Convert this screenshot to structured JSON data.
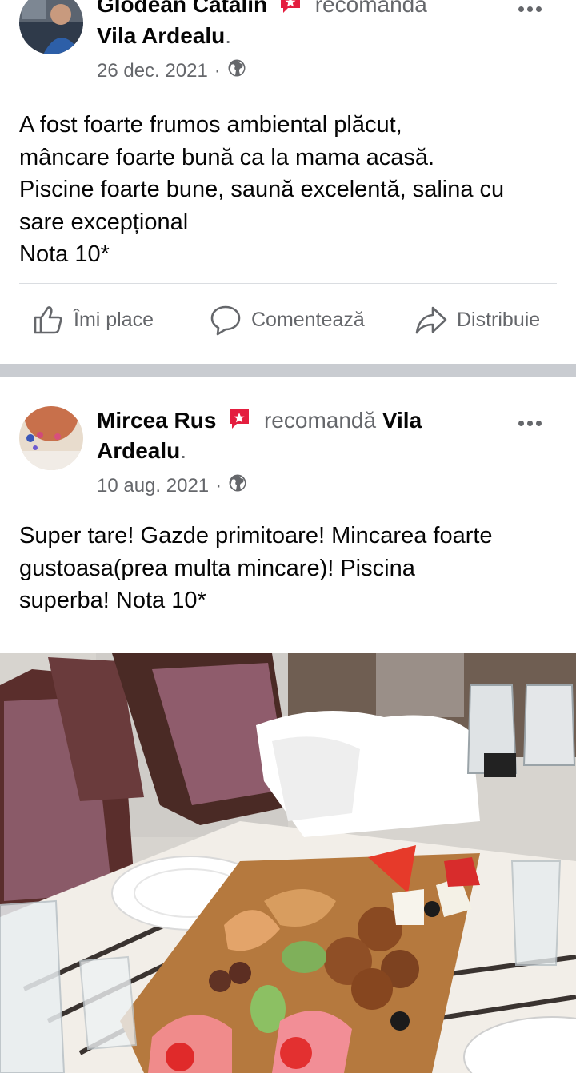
{
  "posts": [
    {
      "author": "Glodean Catalin",
      "verb": "recomandă",
      "page": "Vila Ardealu",
      "punct": ".",
      "date": "26 dec. 2021",
      "separator": "·",
      "privacy_icon": "globe-icon",
      "text_lines": [
        "A fost foarte frumos ambiental plăcut,",
        "mâncare foarte bună ca la mama acasă.",
        "Piscine foarte bune, saună excelentă, salina cu",
        "sare excepțional",
        "Nota 10*"
      ],
      "actions": {
        "like": "Îmi place",
        "comment": "Comentează",
        "share": "Distribuie"
      }
    },
    {
      "author": "Mircea Rus",
      "verb": "recomandă",
      "page_part1": "Vila",
      "page_part2": "Ardealu",
      "punct": ".",
      "date": "10 aug. 2021",
      "separator": "·",
      "privacy_icon": "globe-icon",
      "text_lines": [
        "Super tare! Gazde primitoare! Mincarea foarte",
        "gustoasa(prea multa mincare)! Piscina",
        "superba! Nota 10*"
      ]
    }
  ],
  "colors": {
    "badge": "#e41e3f",
    "secondary_text": "#65676b",
    "separator": "#c9ccd1"
  }
}
